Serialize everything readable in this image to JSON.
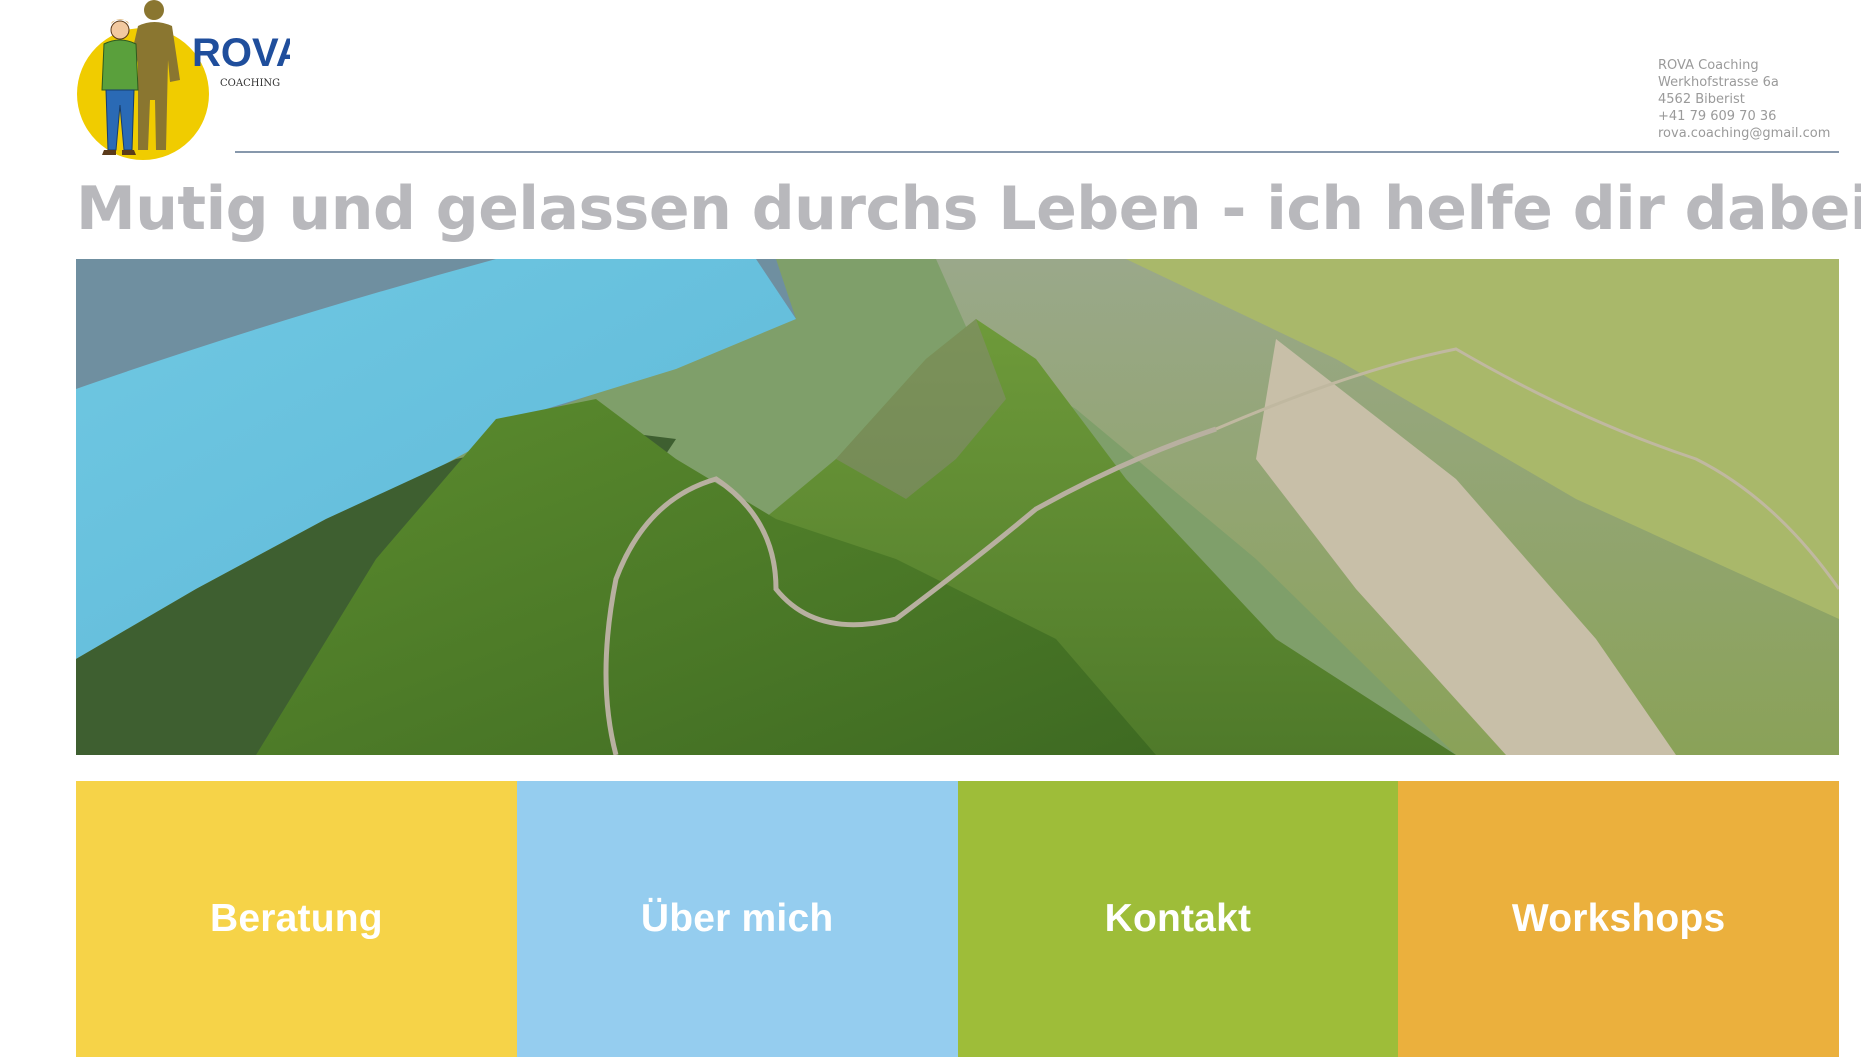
{
  "brand": {
    "name": "ROVA",
    "tagline": "COACHING"
  },
  "contact": {
    "company": "ROVA Coaching",
    "street": "Werkhofstrasse 6a",
    "city": "4562 Biberist",
    "phone": "+41 79 609 70 36",
    "email": "rova.coaching@gmail.com"
  },
  "headline": "Mutig und gelassen durchs Leben - ich helfe dir dabei",
  "tiles": [
    {
      "label": "Beratung",
      "color": "#f6d348"
    },
    {
      "label": "Über mich",
      "color": "#95cdef"
    },
    {
      "label": "Kontakt",
      "color": "#9ebd39"
    },
    {
      "label": "Workshops",
      "color": "#ebb03d"
    }
  ],
  "colors": {
    "headline": "#b8b8bc",
    "rule": "#8798ac",
    "logo_circle": "#f0cc00",
    "logo_text": "#1f4e9c"
  }
}
